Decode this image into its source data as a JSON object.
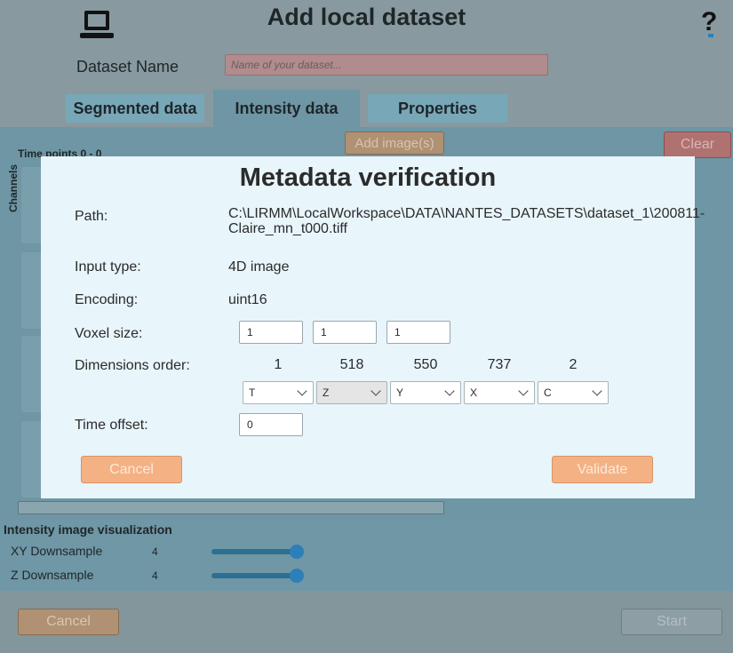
{
  "window": {
    "title": "Add local dataset",
    "help_label": "?"
  },
  "dataset": {
    "label": "Dataset Name",
    "placeholder": "Name of your dataset..."
  },
  "tabs": [
    {
      "label": "Segmented data",
      "active": false
    },
    {
      "label": "Intensity data",
      "active": true
    },
    {
      "label": "Properties",
      "active": false
    }
  ],
  "intensity_panel": {
    "add_images_label": "Add image(s)",
    "clear_label": "Clear",
    "time_points_label": "Time points    0 - 0",
    "channels_label": "Channels"
  },
  "visualization": {
    "title": "Intensity image visualization",
    "xy_label": "XY Downsample",
    "xy_value": "4",
    "z_label": "Z Downsample",
    "z_value": "4"
  },
  "footer": {
    "cancel_label": "Cancel",
    "start_label": "Start"
  },
  "modal": {
    "title": "Metadata verification",
    "path_label": "Path:",
    "path_value": "C:\\LIRMM\\LocalWorkspace\\DATA\\NANTES_DATASETS\\dataset_1\\200811-Claire_mn_t000.tiff",
    "input_type_label": "Input type:",
    "input_type_value": "4D image",
    "encoding_label": "Encoding:",
    "encoding_value": "uint16",
    "voxel_label": "Voxel size:",
    "voxel_values": [
      "1",
      "1",
      "1"
    ],
    "dims_label": "Dimensions order:",
    "dims_sizes": [
      "1",
      "518",
      "550",
      "737",
      "2"
    ],
    "dims_axes": [
      "T",
      "Z",
      "Y",
      "X",
      "C"
    ],
    "time_offset_label": "Time offset:",
    "time_offset_value": "0",
    "cancel_label": "Cancel",
    "validate_label": "Validate"
  },
  "colors": {
    "accent": "#f4b183",
    "slider": "#2c7fb8",
    "modal_bg": "#e8f5fb"
  }
}
